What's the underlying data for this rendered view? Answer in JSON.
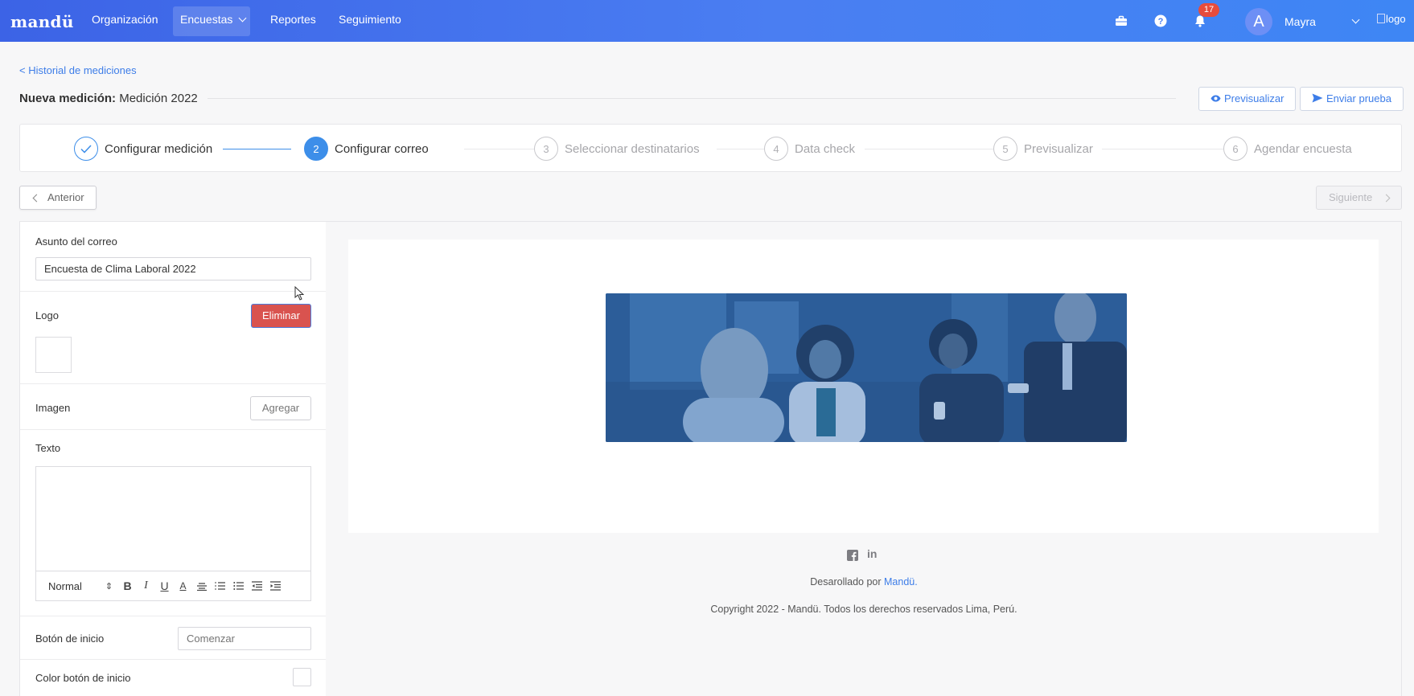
{
  "nav": {
    "brand": "mandü",
    "items": [
      "Organización",
      "Encuestas",
      "Reportes",
      "Seguimiento"
    ],
    "notifications_count": "17",
    "user_initial": "A",
    "user_name": "Mayra",
    "logo_alt": "logo"
  },
  "header": {
    "back_link": "Historial de mediciones",
    "title_prefix": "Nueva medición:",
    "title_value": "Medición 2022",
    "preview_button": "Previsualizar",
    "send_test_button": "Enviar prueba"
  },
  "stepper": {
    "steps": [
      {
        "number": "1",
        "label": "Configurar medición",
        "state": "done"
      },
      {
        "number": "2",
        "label": "Configurar correo",
        "state": "active"
      },
      {
        "number": "3",
        "label": "Seleccionar destinatarios",
        "state": "pending"
      },
      {
        "number": "4",
        "label": "Data check",
        "state": "pending"
      },
      {
        "number": "5",
        "label": "Previsualizar",
        "state": "pending"
      },
      {
        "number": "6",
        "label": "Agendar encuesta",
        "state": "pending"
      }
    ]
  },
  "controls": {
    "prev": "Anterior",
    "next": "Siguiente"
  },
  "form": {
    "subject_label": "Asunto del correo",
    "subject_value": "Encuesta de Clima Laboral 2022",
    "logo_label": "Logo",
    "delete_button": "Eliminar",
    "image_label": "Imagen",
    "add_button": "Agregar",
    "text_label": "Texto",
    "format_select": "Normal",
    "start_button_label": "Botón de inicio",
    "start_button_placeholder": "Comenzar",
    "start_color_label": "Color botón de inicio"
  },
  "preview": {
    "social": [
      "facebook-icon",
      "linkedin-icon"
    ],
    "developed_by": "Desarollado por",
    "developed_brand": "Mandü.",
    "copyright": "Copyright 2022 - Mandü. Todos los derechos reservados Lima, Perú."
  },
  "colors": {
    "primary": "#3d8ee9",
    "danger": "#d9534f",
    "nav_start": "#3c63e6",
    "nav_end": "#3e86f4"
  }
}
